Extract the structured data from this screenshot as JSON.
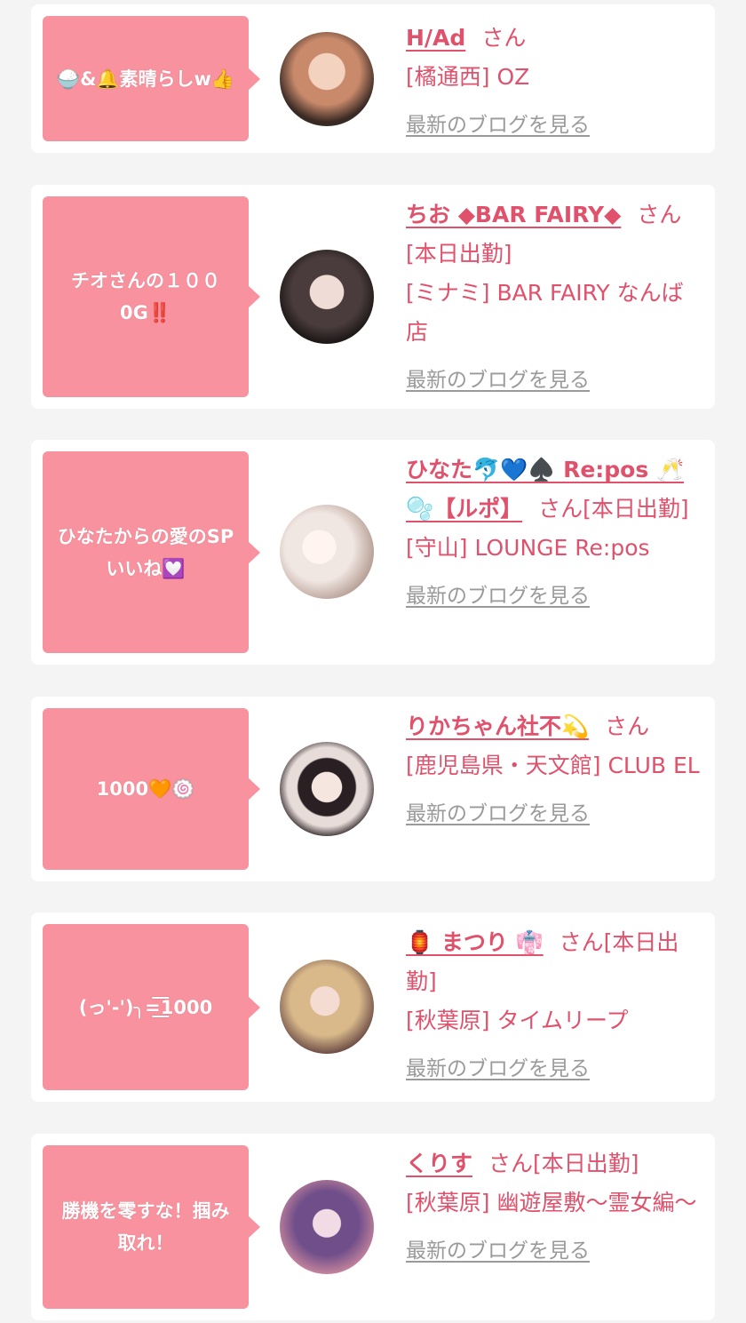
{
  "cards": [
    {
      "bubble": "🍚&🔔素晴らしw👍",
      "name": "H/Ad",
      "san": "さん",
      "lines": [
        "[橘通西] OZ"
      ],
      "blog": "最新のブログを見る",
      "colors": {
        "a": "#c98a6b",
        "b": "#3a2a24"
      }
    },
    {
      "bubble": "チオさんの１００ 0G‼️",
      "name": "ちお ◆BAR FAIRY◆",
      "san": "さん",
      "lines": [
        "[本日出勤]",
        "[ミナミ] BAR FAIRY なんば店"
      ],
      "blog": "最新のブログを見る",
      "colors": {
        "a": "#4a3c3c",
        "b": "#1e1818"
      }
    },
    {
      "bubble": "ひなたからの愛のSPいいね💟",
      "name": "ひなた🐬💙♠️ Re:pos 🥂🫧【ルポ】",
      "san": "さん[本日出勤]",
      "lines": [
        "[守山] LOUNGE Re:pos"
      ],
      "blog": "最新のブログを見る",
      "colors": {
        "a": "#f1e7e2",
        "b": "#b49d93"
      }
    },
    {
      "bubble": "1000🧡🍥",
      "name": "りかちゃん社不💫",
      "san": "さん",
      "lines": [
        "[鹿児島県・天文館] CLUB EL"
      ],
      "blog": "最新のブログを見る",
      "colors": {
        "a": "#e7dcd8",
        "b": "#2a2024"
      }
    },
    {
      "bubble": "(っ'-')╮=͟͟͞͞1000",
      "name": "🏮 まつり 👘",
      "san": "さん[本日出勤]",
      "lines": [
        "[秋葉原] タイムリープ"
      ],
      "blog": "最新のブログを見る",
      "colors": {
        "a": "#d9b98a",
        "b": "#5a3a3a"
      }
    },
    {
      "bubble": "勝機を零すな！掴み取れ！",
      "name": "くりす",
      "san": "さん[本日出勤]",
      "lines": [
        "[秋葉原] 幽遊屋敷〜霊女編〜"
      ],
      "blog": "最新のブログを見る",
      "colors": {
        "a": "#6f4e8a",
        "b": "#c9879c"
      }
    }
  ]
}
